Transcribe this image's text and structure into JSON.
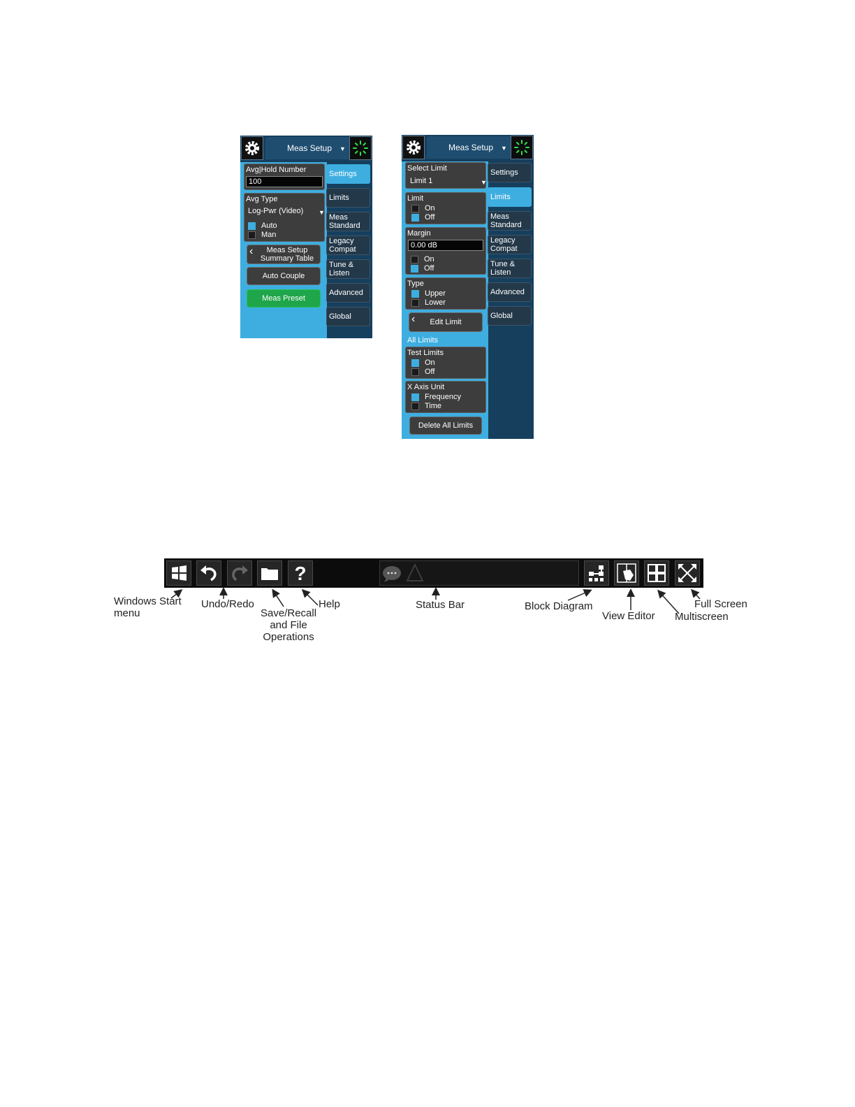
{
  "left_panel": {
    "header": {
      "title": "Meas Setup",
      "dropdown_arrow": "▼"
    },
    "avg_hold": {
      "label": "Avg|Hold Number",
      "value": "100"
    },
    "avg_type": {
      "label": "Avg Type",
      "value": "Log-Pwr (Video)",
      "arrow": "▼",
      "options": [
        "Auto",
        "Man"
      ],
      "selected": "Auto"
    },
    "summary_button": {
      "line1": "Meas Setup",
      "line2": "Summary Table"
    },
    "auto_couple": "Auto Couple",
    "meas_preset": "Meas Preset",
    "tabs": [
      {
        "line1": "Settings",
        "line2": ""
      },
      {
        "line1": "Limits",
        "line2": ""
      },
      {
        "line1": "Meas",
        "line2": "Standard"
      },
      {
        "line1": "Legacy",
        "line2": "Compat"
      },
      {
        "line1": "Tune &",
        "line2": "Listen"
      },
      {
        "line1": "Advanced",
        "line2": ""
      },
      {
        "line1": "Global",
        "line2": ""
      }
    ],
    "active_tab": "Settings"
  },
  "right_panel": {
    "header": {
      "title": "Meas Setup",
      "dropdown_arrow": "▼"
    },
    "select_limit": {
      "label": "Select Limit",
      "value": "Limit 1",
      "arrow": "▼"
    },
    "limit": {
      "label": "Limit",
      "on": "On",
      "off": "Off",
      "selected": "Off"
    },
    "margin": {
      "label": "Margin",
      "value": "0.00 dB",
      "on": "On",
      "off": "Off",
      "selected": "Off"
    },
    "type": {
      "label": "Type",
      "upper": "Upper",
      "lower": "Lower",
      "selected": "Upper"
    },
    "edit_limit": "Edit Limit",
    "all_limits": "All Limits",
    "test_limits": {
      "label": "Test Limits",
      "on": "On",
      "off": "Off",
      "selected": "On"
    },
    "x_axis_unit": {
      "label": "X Axis Unit",
      "frequency": "Frequency",
      "time": "Time",
      "selected": "Frequency"
    },
    "delete_all": "Delete All Limits",
    "tabs": [
      {
        "line1": "Settings",
        "line2": ""
      },
      {
        "line1": "Limits",
        "line2": ""
      },
      {
        "line1": "Meas",
        "line2": "Standard"
      },
      {
        "line1": "Legacy",
        "line2": "Compat"
      },
      {
        "line1": "Tune &",
        "line2": "Listen"
      },
      {
        "line1": "Advanced",
        "line2": ""
      },
      {
        "line1": "Global",
        "line2": ""
      }
    ],
    "active_tab": "Limits"
  },
  "toolbar": {
    "buttons": [
      "windows-start-icon",
      "undo-icon",
      "redo-icon",
      "folder-icon",
      "help-icon",
      "block-diagram-icon",
      "view-editor-icon",
      "multiscreen-icon",
      "full-screen-icon"
    ],
    "help_glyph": "?",
    "captions": {
      "windows_start": "Windows Start\nmenu",
      "undo_redo": "Undo/Redo",
      "save_recall": "Save/Recall\nand File\nOperations",
      "help": "Help",
      "status_bar": "Status Bar",
      "block_diagram": "Block Diagram",
      "view_editor": "View Editor",
      "multiscreen": "Multiscreen",
      "full_screen": "Full Screen"
    }
  },
  "colors": {
    "panel_bg": "#163f5e",
    "accent_blue": "#3eaee0",
    "group_bg": "#3d3d3d",
    "preset_green": "#1fa64a",
    "toolbar_bg": "#0c0c0c"
  }
}
